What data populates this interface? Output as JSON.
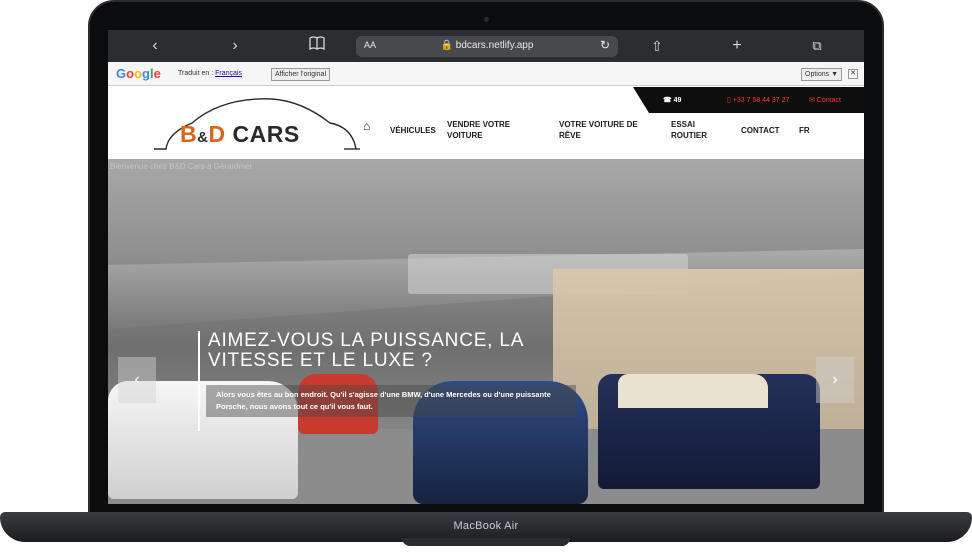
{
  "device": {
    "label": "MacBook Air"
  },
  "browser": {
    "back": "‹",
    "forward": "›",
    "bookmarks_icon": "book-icon",
    "text_size": "AA",
    "url": "🔒 bdcars.netlify.app",
    "reload": "↻",
    "share": "⇧",
    "new_tab": "+",
    "tabs": "⧉"
  },
  "translate_bar": {
    "logo": [
      "G",
      "o",
      "o",
      "g",
      "l",
      "e"
    ],
    "translated_to": "Traduit en :",
    "language": "Français",
    "show_original": "Afficher l'original",
    "options": "Options ▼",
    "close": "✕"
  },
  "header": {
    "views": "☎ 49",
    "phone": "▯ +33 7 58 44 37 27",
    "contact": "✉ Contact",
    "logo": {
      "b": "B",
      "amp": "&",
      "d": "D",
      "cars": " CARS"
    },
    "nav": [
      {
        "label": "⌂"
      },
      {
        "label": "VÉHICULES"
      },
      {
        "label": "VENDRE VOTRE VOITURE"
      },
      {
        "label": "VOTRE VOITURE DE RÊVE"
      },
      {
        "label": "ESSAI ROUTIER"
      },
      {
        "label": "CONTACT"
      },
      {
        "label": "FR"
      }
    ]
  },
  "hero": {
    "ghost_text": "Bienvenue chez B&D Cars à Gérardmer",
    "title": "AIMEZ-VOUS LA PUISSANCE, LA VITESSE ET LE LUXE ?",
    "description": "Alors vous êtes au bon endroit. Qu'il s'agisse d'une BMW, d'une Mercedes ou d'une puissante Porsche, nous avons tout ce qu'il vous faut.",
    "prev": "‹",
    "next": "›"
  }
}
